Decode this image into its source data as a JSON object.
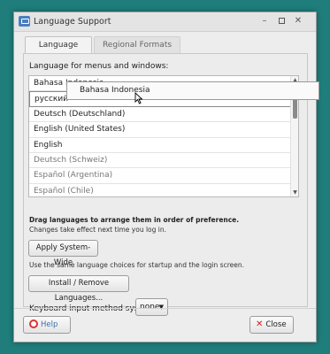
{
  "window": {
    "title": "Language Support",
    "controls": {
      "minimize": "–",
      "close": "✕"
    }
  },
  "tabs": [
    {
      "label": "Language",
      "selected": true
    },
    {
      "label": "Regional Formats",
      "selected": false
    }
  ],
  "language_tab": {
    "menus_label": "Language for menus and windows:",
    "languages": [
      "Bahasa Indonesia",
      "русский",
      "Deutsch (Deutschland)",
      "English (United States)",
      "English",
      "Deutsch (Schweiz)",
      "Español (Argentina)",
      "Español (Chile)"
    ],
    "drag_ghost_label": "Bahasa Indonesia",
    "drag_note": "Drag languages to arrange them in order of preference.",
    "change_note": "Changes take effect next time you log in.",
    "apply_button": "Apply System-Wide",
    "startup_note": "Use the same language choices for startup and the login screen.",
    "install_button": "Install / Remove Languages...",
    "keyboard_label": "Keyboard input method system:",
    "keyboard_value": "none"
  },
  "footer": {
    "help_button": "Help",
    "close_button": "Close"
  },
  "colors": {
    "desktop": "#1f7e7b",
    "help_accent": "#3a6fb0",
    "close_icon": "#cc2222"
  }
}
